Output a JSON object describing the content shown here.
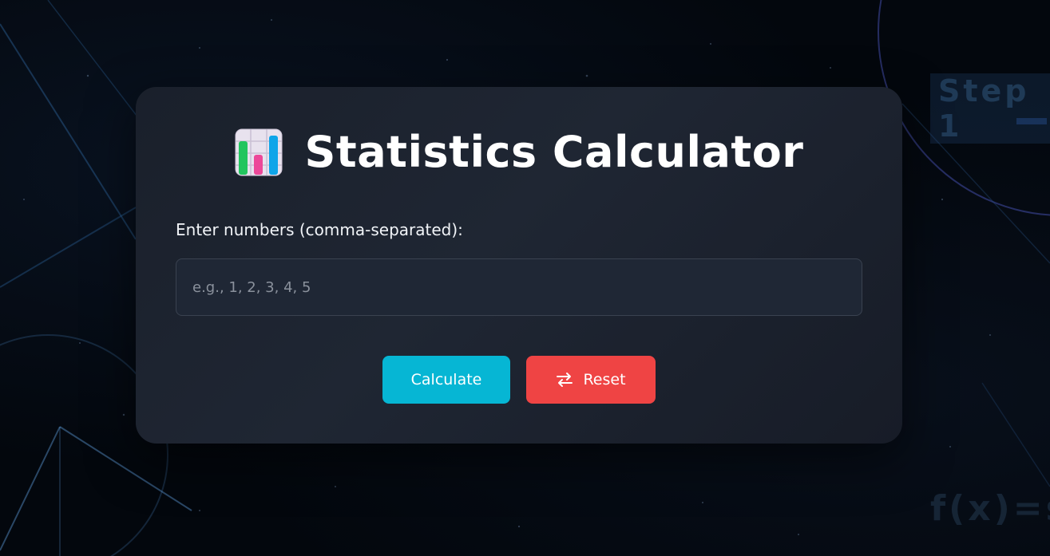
{
  "background": {
    "step_text": "Step 1",
    "formula_text": "f(x)=s"
  },
  "app": {
    "logo_icon": "bar-chart-icon",
    "title": "Statistics Calculator"
  },
  "form": {
    "label": "Enter numbers (comma-separated):",
    "input_value": "",
    "input_placeholder": "e.g., 1, 2, 3, 4, 5"
  },
  "buttons": {
    "calculate_label": "Calculate",
    "reset_label": "Reset",
    "reset_icon": "swap-arrows-icon"
  },
  "colors": {
    "calculate": "#06b6d4",
    "reset": "#ef4444",
    "card": "#1f2633"
  }
}
